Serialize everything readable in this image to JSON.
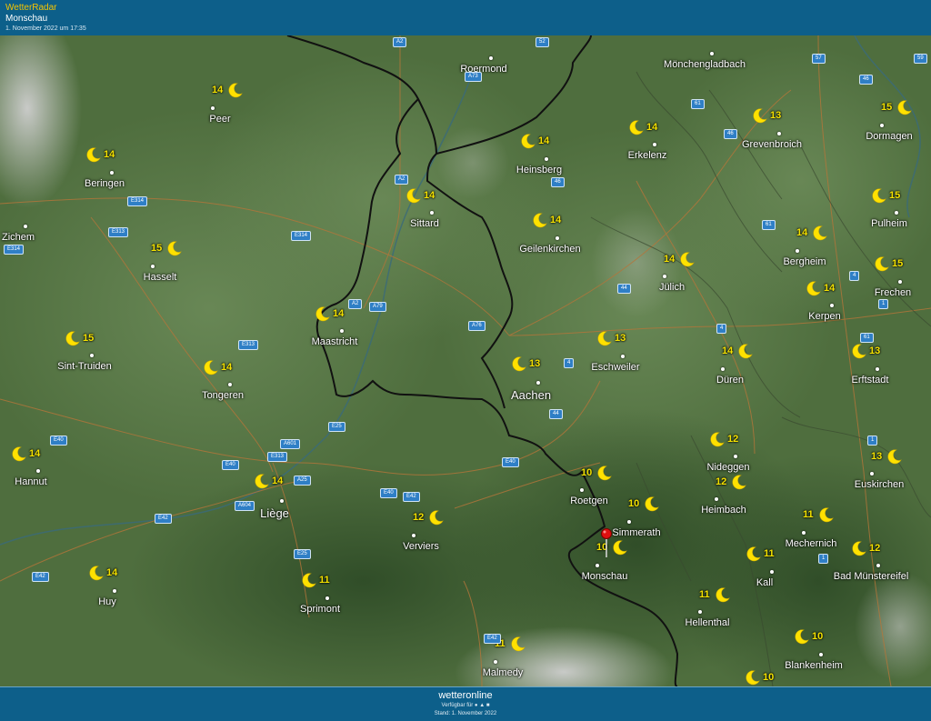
{
  "header": {
    "app_name": "WetterRadar",
    "location": "Monschau",
    "timestamp": "1. November 2022 um 17:35"
  },
  "footer": {
    "brand": "wetteronline",
    "available": "Verfügbar für",
    "stand": "Stand: 1. November 2022"
  },
  "map": {
    "icon": "moon-icon",
    "colors": {
      "temp": "#f4e200",
      "moon": "#ffe100",
      "road_badge": "#2f7fc6",
      "border": "#111111",
      "terrain": "#4a6b3a"
    },
    "selected_location": "Monschau",
    "cities": [
      {
        "name": "Peer",
        "temp": "14"
      },
      {
        "name": "Beringen",
        "temp": "14"
      },
      {
        "name": "Zichem",
        "temp": ""
      },
      {
        "name": "Hasselt",
        "temp": "15"
      },
      {
        "name": "Sint-Truiden",
        "temp": "15"
      },
      {
        "name": "Tongeren",
        "temp": "14"
      },
      {
        "name": "Hannut",
        "temp": "14"
      },
      {
        "name": "Liège",
        "temp": "14"
      },
      {
        "name": "Huy",
        "temp": "14"
      },
      {
        "name": "Sprimont",
        "temp": "11"
      },
      {
        "name": "Verviers",
        "temp": "12"
      },
      {
        "name": "Maastricht",
        "temp": "14"
      },
      {
        "name": "Sittard",
        "temp": "14"
      },
      {
        "name": "Roermond",
        "temp": ""
      },
      {
        "name": "Heinsberg",
        "temp": "14"
      },
      {
        "name": "Geilenkirchen",
        "temp": "14"
      },
      {
        "name": "Erkelenz",
        "temp": "14"
      },
      {
        "name": "Mönchengladbach",
        "temp": ""
      },
      {
        "name": "Grevenbroich",
        "temp": "13"
      },
      {
        "name": "Dormagen",
        "temp": "15"
      },
      {
        "name": "Pulheim",
        "temp": "15"
      },
      {
        "name": "Bergheim",
        "temp": "14"
      },
      {
        "name": "Frechen",
        "temp": "15"
      },
      {
        "name": "Kerpen",
        "temp": "14"
      },
      {
        "name": "Jülich",
        "temp": "14"
      },
      {
        "name": "Eschweiler",
        "temp": "13"
      },
      {
        "name": "Aachen",
        "temp": "13"
      },
      {
        "name": "Düren",
        "temp": "14"
      },
      {
        "name": "Erftstadt",
        "temp": "13"
      },
      {
        "name": "Nideggen",
        "temp": "12"
      },
      {
        "name": "Heimbach",
        "temp": "12"
      },
      {
        "name": "Euskirchen",
        "temp": "13"
      },
      {
        "name": "Roetgen",
        "temp": "10"
      },
      {
        "name": "Simmerath",
        "temp": "10"
      },
      {
        "name": "Monschau",
        "temp": "10"
      },
      {
        "name": "Mechernich",
        "temp": "11"
      },
      {
        "name": "Kall",
        "temp": "11"
      },
      {
        "name": "Bad Münstereifel",
        "temp": "12"
      },
      {
        "name": "Hellenthal",
        "temp": "11"
      },
      {
        "name": "Blankenheim",
        "temp": "10"
      },
      {
        "name": "Malmedy",
        "temp": "11"
      },
      {
        "name": "",
        "temp": "10"
      }
    ],
    "roads": [
      "A2",
      "52",
      "57",
      "46",
      "59",
      "A73",
      "61",
      "46",
      "A2",
      "46",
      "E314",
      "E313",
      "E314",
      "E314",
      "61",
      "4",
      "A2",
      "A79",
      "44",
      "A76",
      "1",
      "4",
      "4",
      "61",
      "E313",
      "E25",
      "A601",
      "E40",
      "E313",
      "E40",
      "A25",
      "E40",
      "E40",
      "E42",
      "44",
      "A604",
      "E42",
      "1",
      "E25",
      "1",
      "E42",
      "E42"
    ]
  }
}
